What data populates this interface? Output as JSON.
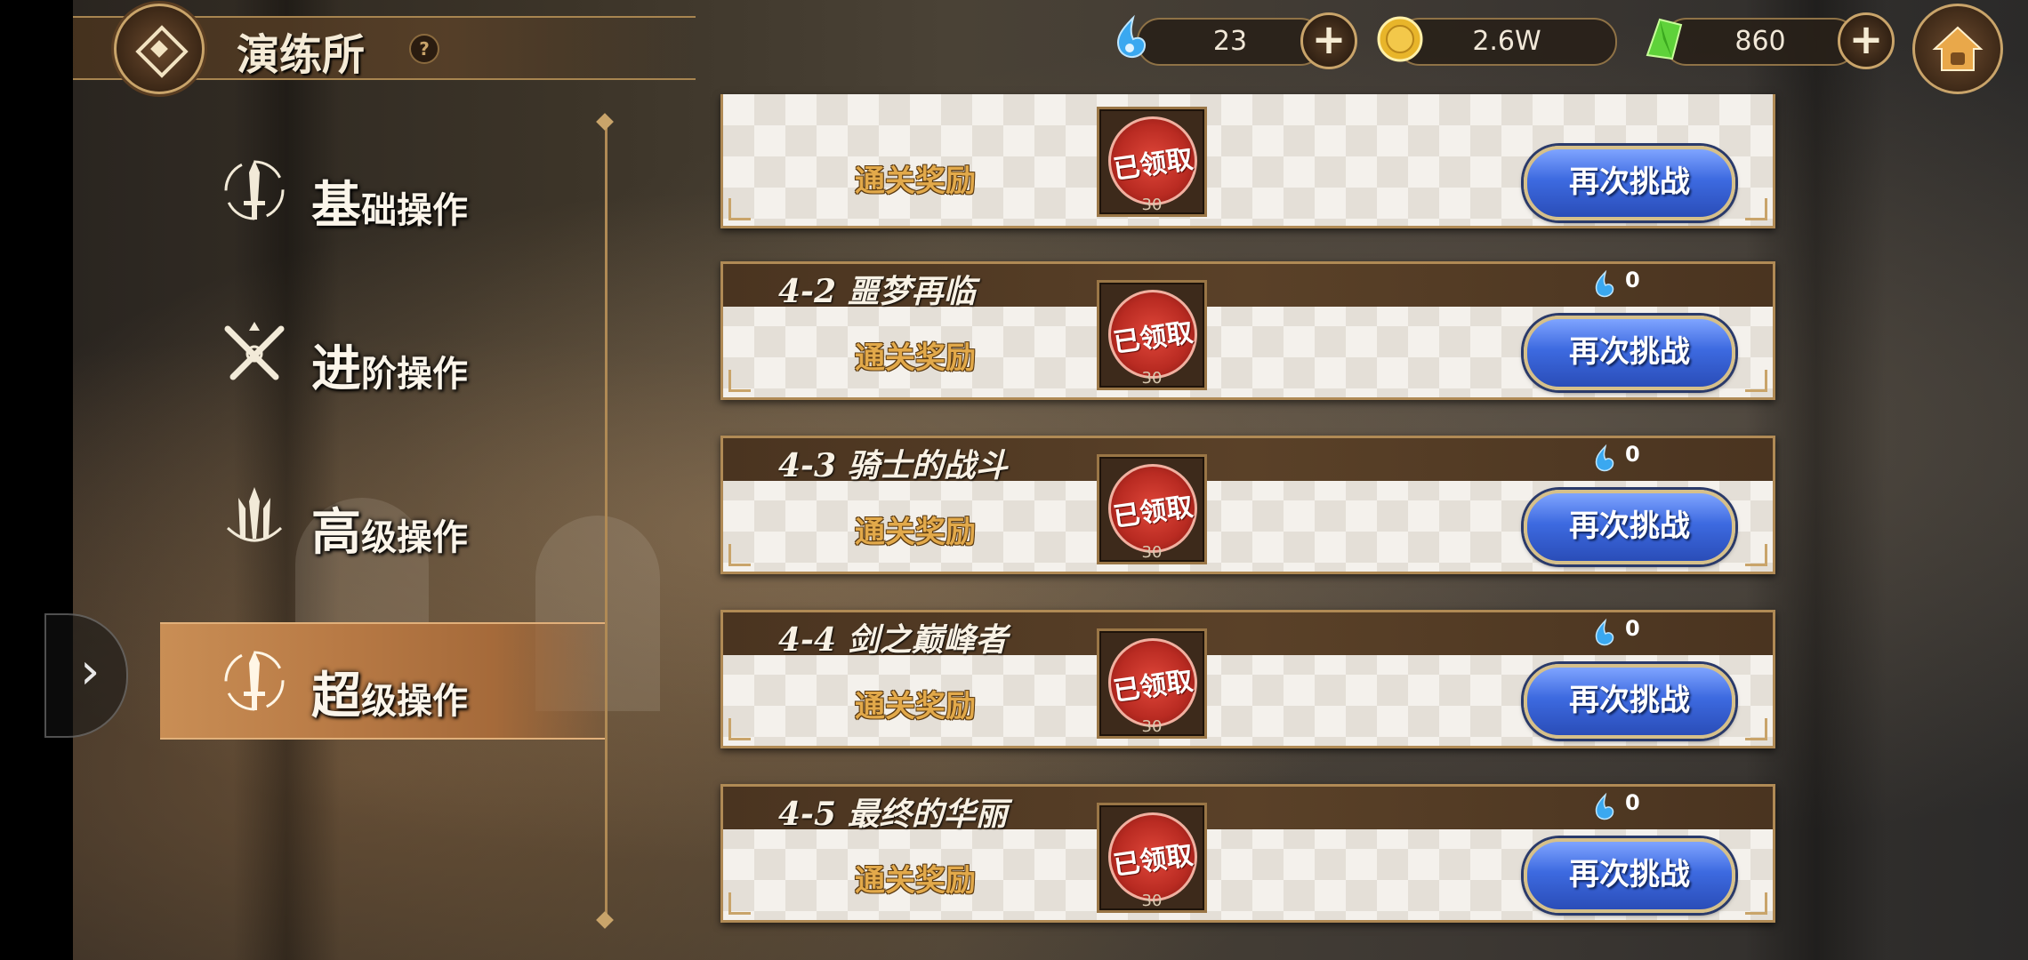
{
  "header": {
    "title": "演练所",
    "help_icon": "?"
  },
  "resources": [
    {
      "name": "blue-drop",
      "value": "23"
    },
    {
      "name": "gold-coin",
      "value": "2.6W"
    },
    {
      "name": "green-crystal",
      "value": "860"
    }
  ],
  "menu": {
    "items": [
      {
        "big": "基",
        "small": "础操作",
        "icon": "sword-circle-icon"
      },
      {
        "big": "进",
        "small": "阶操作",
        "icon": "crossed-swords-icon"
      },
      {
        "big": "高",
        "small": "级操作",
        "icon": "triple-swords-icon"
      },
      {
        "big": "超",
        "small": "级操作",
        "icon": "sword-circle-icon",
        "active": true
      }
    ],
    "collapse_icon": "›"
  },
  "stages": [
    {
      "name": "",
      "drops": "",
      "reward_label": "通关奖励",
      "stamp": "已领取",
      "reward_num": "30",
      "button": "再次挑战"
    },
    {
      "name": "4-2 噩梦再临",
      "drops": "0",
      "reward_label": "通关奖励",
      "stamp": "已领取",
      "reward_num": "30",
      "button": "再次挑战"
    },
    {
      "name": "4-3 骑士的战斗",
      "drops": "0",
      "reward_label": "通关奖励",
      "stamp": "已领取",
      "reward_num": "30",
      "button": "再次挑战"
    },
    {
      "name": "4-4 剑之巅峰者",
      "drops": "0",
      "reward_label": "通关奖励",
      "stamp": "已领取",
      "reward_num": "30",
      "button": "再次挑战"
    },
    {
      "name": "4-5 最终的华丽",
      "drops": "0",
      "reward_label": "通关奖励",
      "stamp": "已领取",
      "reward_num": "30",
      "button": "再次挑战"
    }
  ],
  "colors": {
    "accent_gold": "#c9a46a",
    "header_brown": "#4a3420",
    "button_blue": "#3d6ae0",
    "stamp_red": "#b92b22",
    "active_menu": "#b87a45"
  }
}
